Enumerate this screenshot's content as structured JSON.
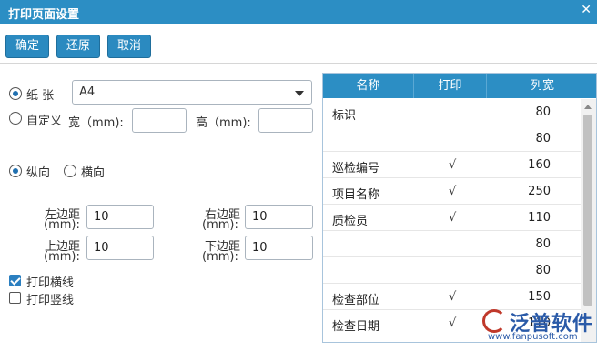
{
  "window": {
    "title": "打印页面设置"
  },
  "toolbar": {
    "confirm": "确定",
    "restore": "还原",
    "cancel": "取消"
  },
  "paper": {
    "mode_paper_label": "纸 张",
    "paper_value": "A4",
    "mode_custom_label": "自定义",
    "width_label": "宽（mm):",
    "width_value": "",
    "height_label": "高（mm):",
    "height_value": "",
    "selected_mode": "paper"
  },
  "orientation": {
    "portrait": "纵向",
    "landscape": "横向",
    "selected": "portrait"
  },
  "margins": {
    "left_label_1": "左边距",
    "left_label_2": "(mm):",
    "left_value": "10",
    "right_label_1": "右边距",
    "right_label_2": "(mm):",
    "right_value": "10",
    "top_label_1": "上边距",
    "top_label_2": "(mm):",
    "top_value": "10",
    "bottom_label_1": "下边距",
    "bottom_label_2": "(mm):",
    "bottom_value": "10"
  },
  "options": {
    "print_hlines_label": "打印横线",
    "print_hlines_checked": true,
    "print_vlines_label": "打印竖线",
    "print_vlines_checked": false
  },
  "columns_grid": {
    "headers": [
      "名称",
      "打印",
      "列宽"
    ],
    "rows": [
      {
        "name": "标识",
        "print": "",
        "width": "80"
      },
      {
        "name": "",
        "print": "",
        "width": "80"
      },
      {
        "name": "巡检编号",
        "print": "√",
        "width": "160"
      },
      {
        "name": "项目名称",
        "print": "√",
        "width": "250"
      },
      {
        "name": "质检员",
        "print": "√",
        "width": "110"
      },
      {
        "name": "",
        "print": "",
        "width": "80"
      },
      {
        "name": "",
        "print": "",
        "width": "80"
      },
      {
        "name": "检查部位",
        "print": "√",
        "width": "150"
      },
      {
        "name": "检查日期",
        "print": "√",
        "width": "110"
      }
    ]
  },
  "watermark": {
    "brand": "泛普软件",
    "url": "www.fanpusoft.com"
  },
  "colors": {
    "header_blue": "#2c8ec4",
    "button_blue": "#2b8ac0"
  }
}
